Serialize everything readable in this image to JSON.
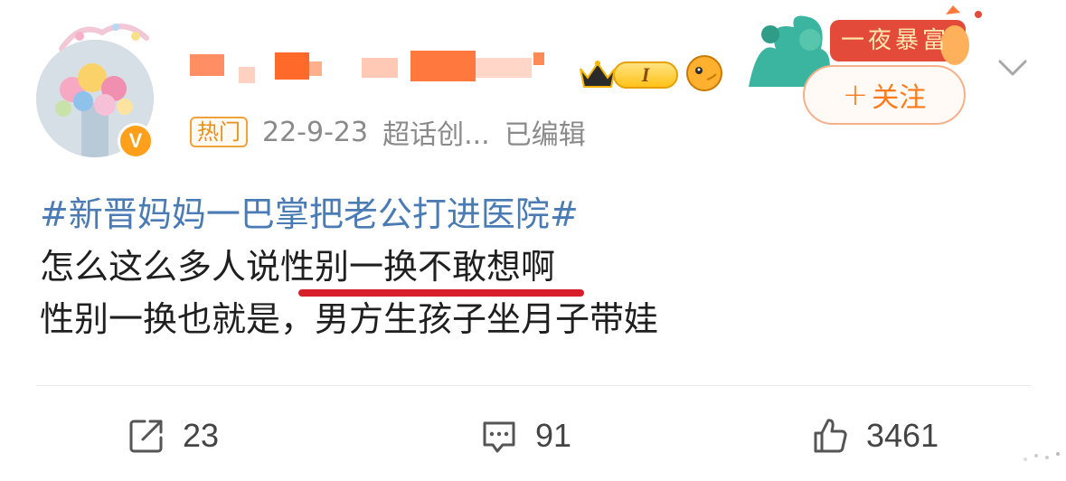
{
  "header": {
    "follow_label": "关注",
    "follow_plus": "+",
    "level": "I",
    "banner_text": "一夜暴富"
  },
  "meta": {
    "hot_tag": "热门",
    "date": "22-9-23",
    "source": "超话创...",
    "edited": "已编辑"
  },
  "post": {
    "topic": "#新晋妈妈一巴掌把老公打进医院#",
    "line1": "怎么这么多人说性别一换不敢想啊",
    "line2": "性别一换也就是，男方生孩子坐月子带娃"
  },
  "actions": {
    "repost_count": "23",
    "comment_count": "91",
    "like_count": "3461"
  },
  "colors": {
    "topic": "#4b7bb5",
    "accent": "#ff7a1a",
    "underline": "#d81e2a",
    "verified": "#ff9f1a"
  },
  "icons": [
    "avatar",
    "verified-icon",
    "crown-icon",
    "fish-icon",
    "chevron-down-icon",
    "repost-icon",
    "comment-icon",
    "like-icon"
  ]
}
